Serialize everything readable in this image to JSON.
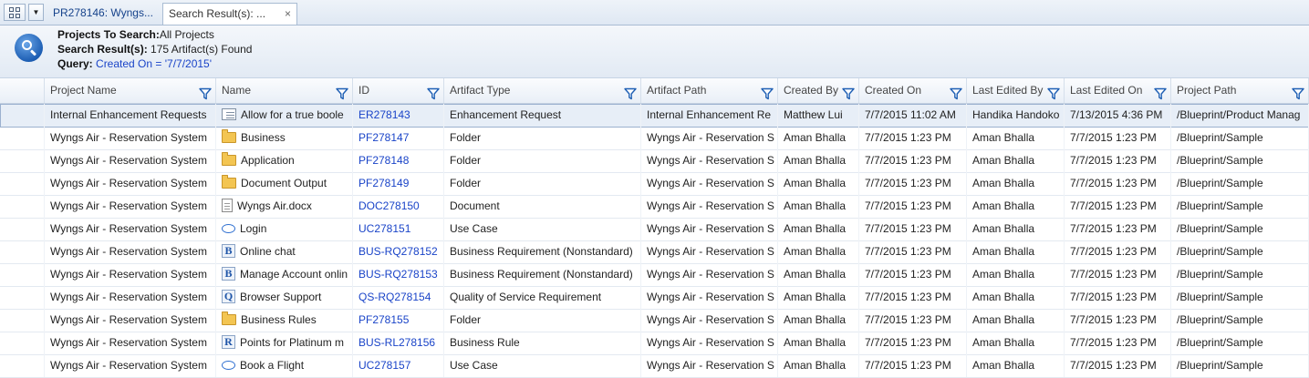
{
  "tabs": [
    {
      "label": "PR278146: Wyngs..."
    },
    {
      "label": "Search Result(s): ...",
      "close": "×"
    }
  ],
  "info": {
    "projects_label": "Projects To Search:",
    "projects_value": "All Projects",
    "results_label": "Search Result(s):",
    "results_value": " 175 Artifact(s) Found",
    "query_label": "Query:",
    "query_value": " Created On = '7/7/2015'"
  },
  "columns": [
    "Project Name",
    "Name",
    "ID",
    "Artifact Type",
    "Artifact Path",
    "Created By",
    "Created On",
    "Last Edited By",
    "Last Edited On",
    "Project Path"
  ],
  "rows": [
    {
      "project": "Internal Enhancement Requests",
      "icon": "enhancement-icon",
      "name": "Allow for a true boole",
      "id": "ER278143",
      "type": "Enhancement Request",
      "path": "Internal Enhancement Re",
      "created_by": "Matthew Lui",
      "created_on": "7/7/2015 11:02 AM",
      "edited_by": "Handika Handoko",
      "edited_on": "7/13/2015 4:36 PM",
      "project_path": "/Blueprint/Product Manag"
    },
    {
      "project": "Wyngs Air - Reservation System",
      "icon": "folder-icon",
      "name": "Business",
      "id": "PF278147",
      "type": "Folder",
      "path": "Wyngs Air - Reservation S",
      "created_by": "Aman Bhalla",
      "created_on": "7/7/2015 1:23 PM",
      "edited_by": "Aman Bhalla",
      "edited_on": "7/7/2015 1:23 PM",
      "project_path": "/Blueprint/Sample"
    },
    {
      "project": "Wyngs Air - Reservation System",
      "icon": "folder-icon",
      "name": "Application",
      "id": "PF278148",
      "type": "Folder",
      "path": "Wyngs Air - Reservation S",
      "created_by": "Aman Bhalla",
      "created_on": "7/7/2015 1:23 PM",
      "edited_by": "Aman Bhalla",
      "edited_on": "7/7/2015 1:23 PM",
      "project_path": "/Blueprint/Sample"
    },
    {
      "project": "Wyngs Air - Reservation System",
      "icon": "folder-icon",
      "name": "Document Output",
      "id": "PF278149",
      "type": "Folder",
      "path": "Wyngs Air - Reservation S",
      "created_by": "Aman Bhalla",
      "created_on": "7/7/2015 1:23 PM",
      "edited_by": "Aman Bhalla",
      "edited_on": "7/7/2015 1:23 PM",
      "project_path": "/Blueprint/Sample"
    },
    {
      "project": "Wyngs Air - Reservation System",
      "icon": "document-icon",
      "name": "Wyngs Air.docx",
      "id": "DOC278150",
      "type": "Document",
      "path": "Wyngs Air - Reservation S",
      "created_by": "Aman Bhalla",
      "created_on": "7/7/2015 1:23 PM",
      "edited_by": "Aman Bhalla",
      "edited_on": "7/7/2015 1:23 PM",
      "project_path": "/Blueprint/Sample"
    },
    {
      "project": "Wyngs Air - Reservation System",
      "icon": "use-case-icon",
      "name": "Login",
      "id": "UC278151",
      "type": "Use Case",
      "path": "Wyngs Air - Reservation S",
      "created_by": "Aman Bhalla",
      "created_on": "7/7/2015 1:23 PM",
      "edited_by": "Aman Bhalla",
      "edited_on": "7/7/2015 1:23 PM",
      "project_path": "/Blueprint/Sample"
    },
    {
      "project": "Wyngs Air - Reservation System",
      "icon": "business-requirement-icon",
      "letter": "B",
      "name": "Online chat",
      "id": "BUS-RQ278152",
      "type": "Business Requirement (Nonstandard)",
      "path": "Wyngs Air - Reservation S",
      "created_by": "Aman Bhalla",
      "created_on": "7/7/2015 1:23 PM",
      "edited_by": "Aman Bhalla",
      "edited_on": "7/7/2015 1:23 PM",
      "project_path": "/Blueprint/Sample"
    },
    {
      "project": "Wyngs Air - Reservation System",
      "icon": "business-requirement-icon",
      "letter": "B",
      "name": "Manage Account onlin",
      "id": "BUS-RQ278153",
      "type": "Business Requirement (Nonstandard)",
      "path": "Wyngs Air - Reservation S",
      "created_by": "Aman Bhalla",
      "created_on": "7/7/2015 1:23 PM",
      "edited_by": "Aman Bhalla",
      "edited_on": "7/7/2015 1:23 PM",
      "project_path": "/Blueprint/Sample"
    },
    {
      "project": "Wyngs Air - Reservation System",
      "icon": "quality-requirement-icon",
      "letter": "Q",
      "name": "Browser Support",
      "id": "QS-RQ278154",
      "type": "Quality of Service Requirement",
      "path": "Wyngs Air - Reservation S",
      "created_by": "Aman Bhalla",
      "created_on": "7/7/2015 1:23 PM",
      "edited_by": "Aman Bhalla",
      "edited_on": "7/7/2015 1:23 PM",
      "project_path": "/Blueprint/Sample"
    },
    {
      "project": "Wyngs Air - Reservation System",
      "icon": "folder-icon",
      "name": "Business Rules",
      "id": "PF278155",
      "type": "Folder",
      "path": "Wyngs Air - Reservation S",
      "created_by": "Aman Bhalla",
      "created_on": "7/7/2015 1:23 PM",
      "edited_by": "Aman Bhalla",
      "edited_on": "7/7/2015 1:23 PM",
      "project_path": "/Blueprint/Sample"
    },
    {
      "project": "Wyngs Air - Reservation System",
      "icon": "business-rule-icon",
      "letter": "R",
      "name": "Points for Platinum m",
      "id": "BUS-RL278156",
      "type": "Business Rule",
      "path": "Wyngs Air - Reservation S",
      "created_by": "Aman Bhalla",
      "created_on": "7/7/2015 1:23 PM",
      "edited_by": "Aman Bhalla",
      "edited_on": "7/7/2015 1:23 PM",
      "project_path": "/Blueprint/Sample"
    },
    {
      "project": "Wyngs Air - Reservation System",
      "icon": "use-case-icon",
      "name": "Book a Flight",
      "id": "UC278157",
      "type": "Use Case",
      "path": "Wyngs Air - Reservation S",
      "created_by": "Aman Bhalla",
      "created_on": "7/7/2015 1:23 PM",
      "edited_by": "Aman Bhalla",
      "edited_on": "7/7/2015 1:23 PM",
      "project_path": "/Blueprint/Sample"
    }
  ]
}
